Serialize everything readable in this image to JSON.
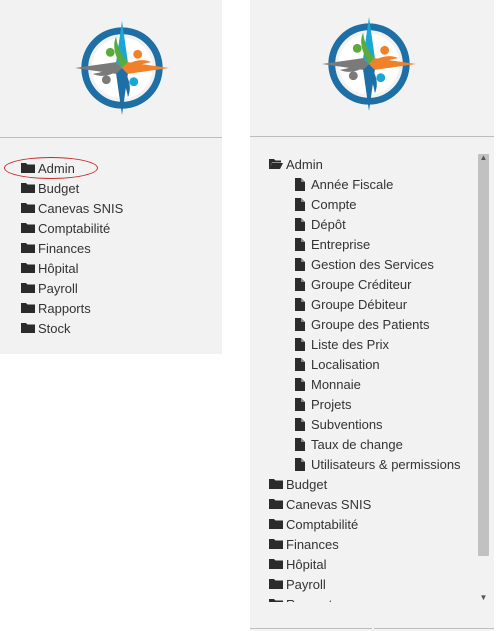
{
  "left": {
    "items": [
      {
        "label": "Admin"
      },
      {
        "label": "Budget"
      },
      {
        "label": "Canevas SNIS"
      },
      {
        "label": "Comptabilité"
      },
      {
        "label": "Finances"
      },
      {
        "label": "Hôpital"
      },
      {
        "label": "Payroll"
      },
      {
        "label": "Rapports"
      },
      {
        "label": "Stock"
      }
    ]
  },
  "right": {
    "admin_label": "Admin",
    "admin_children": [
      {
        "label": "Année Fiscale"
      },
      {
        "label": "Compte"
      },
      {
        "label": "Dépôt"
      },
      {
        "label": "Entreprise"
      },
      {
        "label": "Gestion des Services"
      },
      {
        "label": "Groupe Créditeur"
      },
      {
        "label": "Groupe Débiteur"
      },
      {
        "label": "Groupe des Patients"
      },
      {
        "label": "Liste des Prix"
      },
      {
        "label": "Localisation"
      },
      {
        "label": "Monnaie"
      },
      {
        "label": "Projets"
      },
      {
        "label": "Subventions"
      },
      {
        "label": "Taux de change"
      },
      {
        "label": "Utilisateurs & permissions"
      }
    ],
    "other_folders": [
      {
        "label": "Budget"
      },
      {
        "label": "Canevas SNIS"
      },
      {
        "label": "Comptabilité"
      },
      {
        "label": "Finances"
      },
      {
        "label": "Hôpital"
      },
      {
        "label": "Payroll"
      },
      {
        "label": "Rapports"
      }
    ]
  },
  "icons": {
    "closed_folder": "folder-icon",
    "open_folder": "folder-open-icon",
    "file": "file-icon",
    "logo": "compass-logo"
  },
  "colors": {
    "panel_bg": "#f2f2f2",
    "highlight_ring": "#c62828",
    "logo_blue": "#1d6fa5",
    "logo_green": "#5aab3c",
    "logo_orange": "#f0802a",
    "logo_cyan": "#1aa6d6",
    "logo_grey": "#7a7a7a"
  }
}
